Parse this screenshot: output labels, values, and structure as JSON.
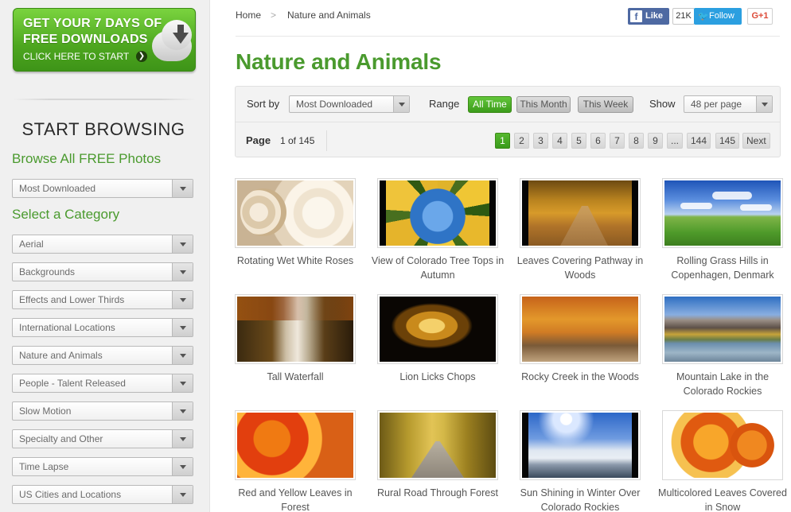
{
  "promo": {
    "line1": "GET YOUR 7 DAYS OF",
    "line2": "FREE DOWNLOADS",
    "line3": "CLICK HERE TO START",
    "arrow": "❯"
  },
  "sidebar": {
    "start_heading": "START BROWSING",
    "browse_heading": "Browse All FREE Photos",
    "browse_select": "Most Downloaded",
    "category_heading": "Select a Category",
    "categories": [
      "Aerial",
      "Backgrounds",
      "Effects and Lower Thirds",
      "International Locations",
      "Nature and Animals",
      "People - Talent Released",
      "Slow Motion",
      "Specialty and Other",
      "Time Lapse",
      "US Cities and Locations"
    ]
  },
  "breadcrumb": {
    "home": "Home",
    "separator": ">",
    "current": "Nature and Animals"
  },
  "social": {
    "like": "Like",
    "like_count": "21K",
    "follow": "Follow",
    "gplus": "G+1",
    "fb_glyph": "f",
    "tw_glyph": "🐦"
  },
  "page_title": "Nature and Animals",
  "toolbar": {
    "sort_label": "Sort by",
    "sort_value": "Most Downloaded",
    "range_label": "Range",
    "range_options": [
      "All Time",
      "This Month",
      "This Week"
    ],
    "range_active": "All Time",
    "show_label": "Show",
    "show_value": "48 per page",
    "page_label": "Page",
    "page_of": "1 of 145",
    "pages": [
      "1",
      "2",
      "3",
      "4",
      "5",
      "6",
      "7",
      "8",
      "9",
      "...",
      "144",
      "145",
      "Next"
    ],
    "current_page": "1"
  },
  "items": [
    {
      "title": "Rotating Wet White Roses"
    },
    {
      "title": "View of Colorado Tree Tops in Autumn"
    },
    {
      "title": "Leaves Covering Pathway in Woods"
    },
    {
      "title": "Rolling Grass Hills in Copenhagen, Denmark"
    },
    {
      "title": "Tall Waterfall"
    },
    {
      "title": "Lion Licks Chops"
    },
    {
      "title": "Rocky Creek in the Woods"
    },
    {
      "title": "Mountain Lake in the Colorado Rockies"
    },
    {
      "title": "Red and Yellow Leaves in Forest"
    },
    {
      "title": "Rural Road Through Forest"
    },
    {
      "title": "Sun Shining in Winter Over Colorado Rockies"
    },
    {
      "title": "Multicolored Leaves Covered in Snow"
    }
  ],
  "colors": {
    "accent_green": "#4a9a2e",
    "facebook": "#4e69a2",
    "twitter": "#2b9fe0",
    "gplus": "#dd4b39"
  }
}
